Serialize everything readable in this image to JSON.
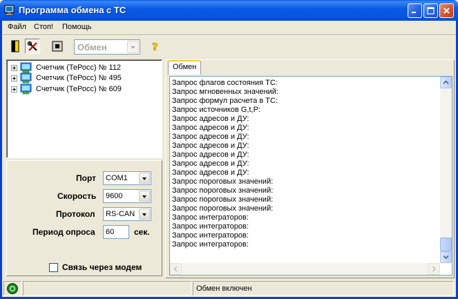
{
  "window": {
    "title": "Программа обмена с ТС"
  },
  "menu": {
    "items": [
      "Файл",
      "Стоп!",
      "Помощь"
    ]
  },
  "toolbar": {
    "mode_combo_value": "Обмен"
  },
  "tree": {
    "items": [
      {
        "label": "Счетчик (ТеРосс) № 112"
      },
      {
        "label": "Счетчик (ТеРосс) № 495"
      },
      {
        "label": "Счетчик (ТеРосс) № 609"
      }
    ]
  },
  "settings": {
    "port_label": "Порт",
    "port_value": "COM1",
    "speed_label": "Скорость",
    "speed_value": "9600",
    "protocol_label": "Протокол",
    "protocol_value": "RS-CAN",
    "period_label": "Период опроса",
    "period_value": "60",
    "period_unit": "сек.",
    "modem_label": "Связь через модем",
    "modem_checked": false
  },
  "tabs": {
    "exchange_label": "Обмен"
  },
  "log": {
    "lines": [
      "Запрос флагов состояния ТС:",
      "Запрос мгновенных значений:",
      "Запрос формул расчета в ТС:",
      "Запрос источников G,t,P:",
      "Запрос адресов и ДУ:",
      "Запрос адресов и ДУ:",
      "Запрос адресов и ДУ:",
      "Запрос адресов и ДУ:",
      "Запрос адресов и ДУ:",
      "Запрос адресов и ДУ:",
      "Запрос адресов и ДУ:",
      "Запрос пороговых значений:",
      "Запрос пороговых значений:",
      "Запрос пороговых значений:",
      "Запрос пороговых значений:",
      "Запрос интеграторов:",
      "Запрос интеграторов:",
      "Запрос интеграторов:",
      "Запрос интеграторов:"
    ]
  },
  "status": {
    "message": "Обмен включен"
  },
  "colors": {
    "titlebar": "#0653e0",
    "window_bg": "#ece9d8",
    "close_button": "#d8542e"
  }
}
